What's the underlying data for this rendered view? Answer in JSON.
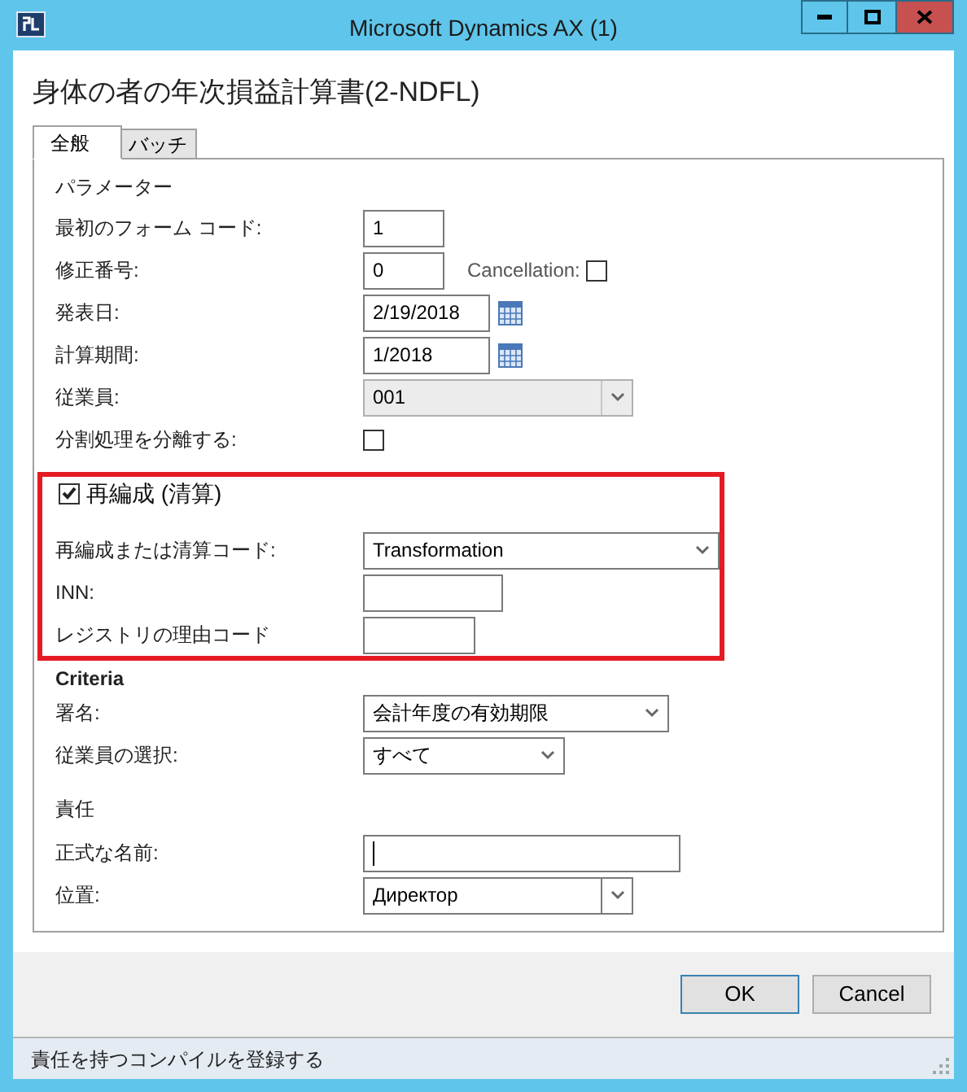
{
  "window": {
    "title": "Microsoft Dynamics AX (1)"
  },
  "form_title": "身体の者の年次損益計算書(2-NDFL)",
  "tabs": [
    {
      "label": "全般",
      "selected": true
    },
    {
      "label": "バッチ",
      "selected": false
    }
  ],
  "sections": [
    {
      "kind": "plain",
      "heading": "パラメーター",
      "fields": [
        {
          "label": "最初のフォーム コード:",
          "kind": "text",
          "value": "1"
        },
        {
          "label": "修正番号:",
          "kind": "text",
          "value": "0",
          "extra": {
            "label": "Cancellation:",
            "checked": false
          }
        },
        {
          "label": "発表日:",
          "kind": "date",
          "value": "2/19/2018"
        },
        {
          "label": "計算期間:",
          "kind": "date",
          "value": "1/2018"
        },
        {
          "label": "従業員:",
          "kind": "lookup",
          "value": "001",
          "disabled": true
        },
        {
          "label": "分割処理を分離する:",
          "kind": "checkbox",
          "checked": false
        }
      ]
    },
    {
      "kind": "checkbox",
      "heading": "再編成 (清算)",
      "checked": true,
      "highlighted": true,
      "fields": [
        {
          "label": "再編成または清算コード:",
          "kind": "combo",
          "value": "Transformation"
        },
        {
          "label": "INN:",
          "kind": "text"
        },
        {
          "label": "レジストリの理由コード",
          "kind": "text"
        }
      ]
    },
    {
      "kind": "bold",
      "heading": "Criteria",
      "fields": [
        {
          "label": "署名:",
          "kind": "combo",
          "value": "会計年度の有効期限"
        },
        {
          "label": "従業員の選択:",
          "kind": "combo",
          "value": "すべて"
        }
      ]
    },
    {
      "kind": "plain",
      "heading": "責任",
      "fields": [
        {
          "label": "正式な名前:",
          "kind": "text",
          "focused": true
        },
        {
          "label": "位置:",
          "kind": "lookup",
          "value": "Директор",
          "disabled": false
        }
      ]
    }
  ],
  "buttons": [
    "OK",
    "Cancel"
  ],
  "status_bar": "責任を持つコンパイルを登録する"
}
